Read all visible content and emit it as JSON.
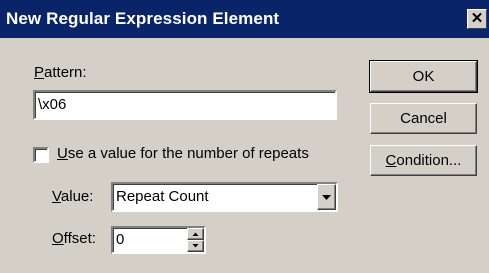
{
  "window": {
    "title": "New Regular Expression Element",
    "close_glyph": "✕"
  },
  "pattern": {
    "label_underlined": "P",
    "label_rest": "attern:",
    "value": "\\x06"
  },
  "repeats_checkbox": {
    "checked": false,
    "label_underlined": "U",
    "label_rest": "se a value for the number of repeats"
  },
  "value_field": {
    "label_underlined": "V",
    "label_rest": "alue:",
    "selected": "Repeat Count"
  },
  "offset_field": {
    "label_underlined": "O",
    "label_rest": "ffset:",
    "value": "0"
  },
  "buttons": {
    "ok": "OK",
    "cancel": "Cancel",
    "condition_underlined": "C",
    "condition_rest": "ondition..."
  },
  "icons": [
    "close-icon",
    "dropdown-arrow-icon",
    "spin-up-icon",
    "spin-down-icon"
  ]
}
